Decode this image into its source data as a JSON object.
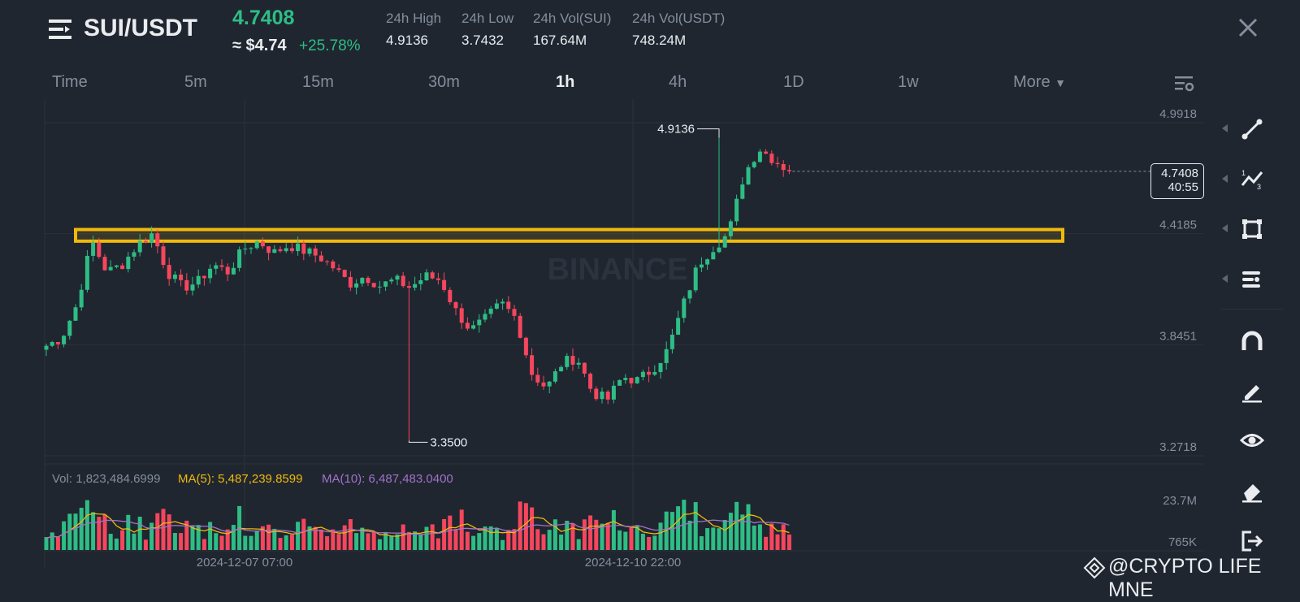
{
  "header": {
    "pair": "SUI/USDT",
    "last_price": "4.7408",
    "usd_price": "≈ $4.74",
    "change_pct": "+25.78%",
    "stats": [
      {
        "label": "24h High",
        "value": "4.9136"
      },
      {
        "label": "24h Low",
        "value": "3.7432"
      },
      {
        "label": "24h Vol(SUI)",
        "value": "167.64M"
      },
      {
        "label": "24h Vol(USDT)",
        "value": "748.24M"
      }
    ]
  },
  "timeframes": [
    "Time",
    "5m",
    "15m",
    "30m",
    "1h",
    "4h",
    "1D",
    "1w",
    "More"
  ],
  "active_timeframe": "1h",
  "tools": [
    "line-tool-icon",
    "fib-tool-icon",
    "rectangle-tool-icon",
    "indicator-tool-icon",
    "magnet-icon",
    "brush-icon",
    "eye-icon",
    "eraser-icon",
    "exit-icon"
  ],
  "watermark": {
    "exchange": "BINANCE",
    "user": "@CRYPTO LIFE MNE"
  },
  "colors": {
    "up": "#2ebd85",
    "down": "#f6465d",
    "ma5": "#f0b90b",
    "ma10": "#a371c8",
    "highlight": "#f0b90b",
    "background": "#1f2630"
  },
  "chart_data": {
    "type": "candlestick",
    "symbol": "SUI/USDT",
    "interval": "1h",
    "price_axis": {
      "ticks": [
        "4.9918",
        "4.4185",
        "3.8451",
        "3.2718"
      ],
      "range": [
        3.2718,
        4.9918
      ]
    },
    "current_price": {
      "value": "4.7408",
      "countdown": "40:55"
    },
    "annotations": {
      "high": "4.9136",
      "low": "3.3500"
    },
    "x_ticks": [
      "2024-12-07 07:00",
      "2024-12-10 22:00"
    ],
    "highlight_zone": {
      "price_low": 4.38,
      "price_high": 4.44,
      "color": "#f0b90b"
    },
    "close_path": [
      3.84,
      3.88,
      4.05,
      4.38,
      4.22,
      4.26,
      4.36,
      4.42,
      4.22,
      4.14,
      4.17,
      4.26,
      4.22,
      4.34,
      4.38,
      4.32,
      4.36,
      4.33,
      4.3,
      4.24,
      4.16,
      4.2,
      4.15,
      4.18,
      4.14,
      4.2,
      4.18,
      4.02,
      3.92,
      3.98,
      4.06,
      3.98,
      3.7,
      3.62,
      3.75,
      3.78,
      3.6,
      3.56,
      3.68,
      3.66,
      3.72,
      3.82,
      4.05,
      4.26,
      4.35,
      4.42,
      4.72,
      4.86,
      4.8,
      4.7408
    ],
    "volume": {
      "last_vol": "1,823,484.6999",
      "ma5_label": "MA(5): 5,487,239.8599",
      "ma10_label": "MA(10): 6,487,483.0400",
      "axis": [
        "23.7M",
        "765K"
      ]
    }
  }
}
